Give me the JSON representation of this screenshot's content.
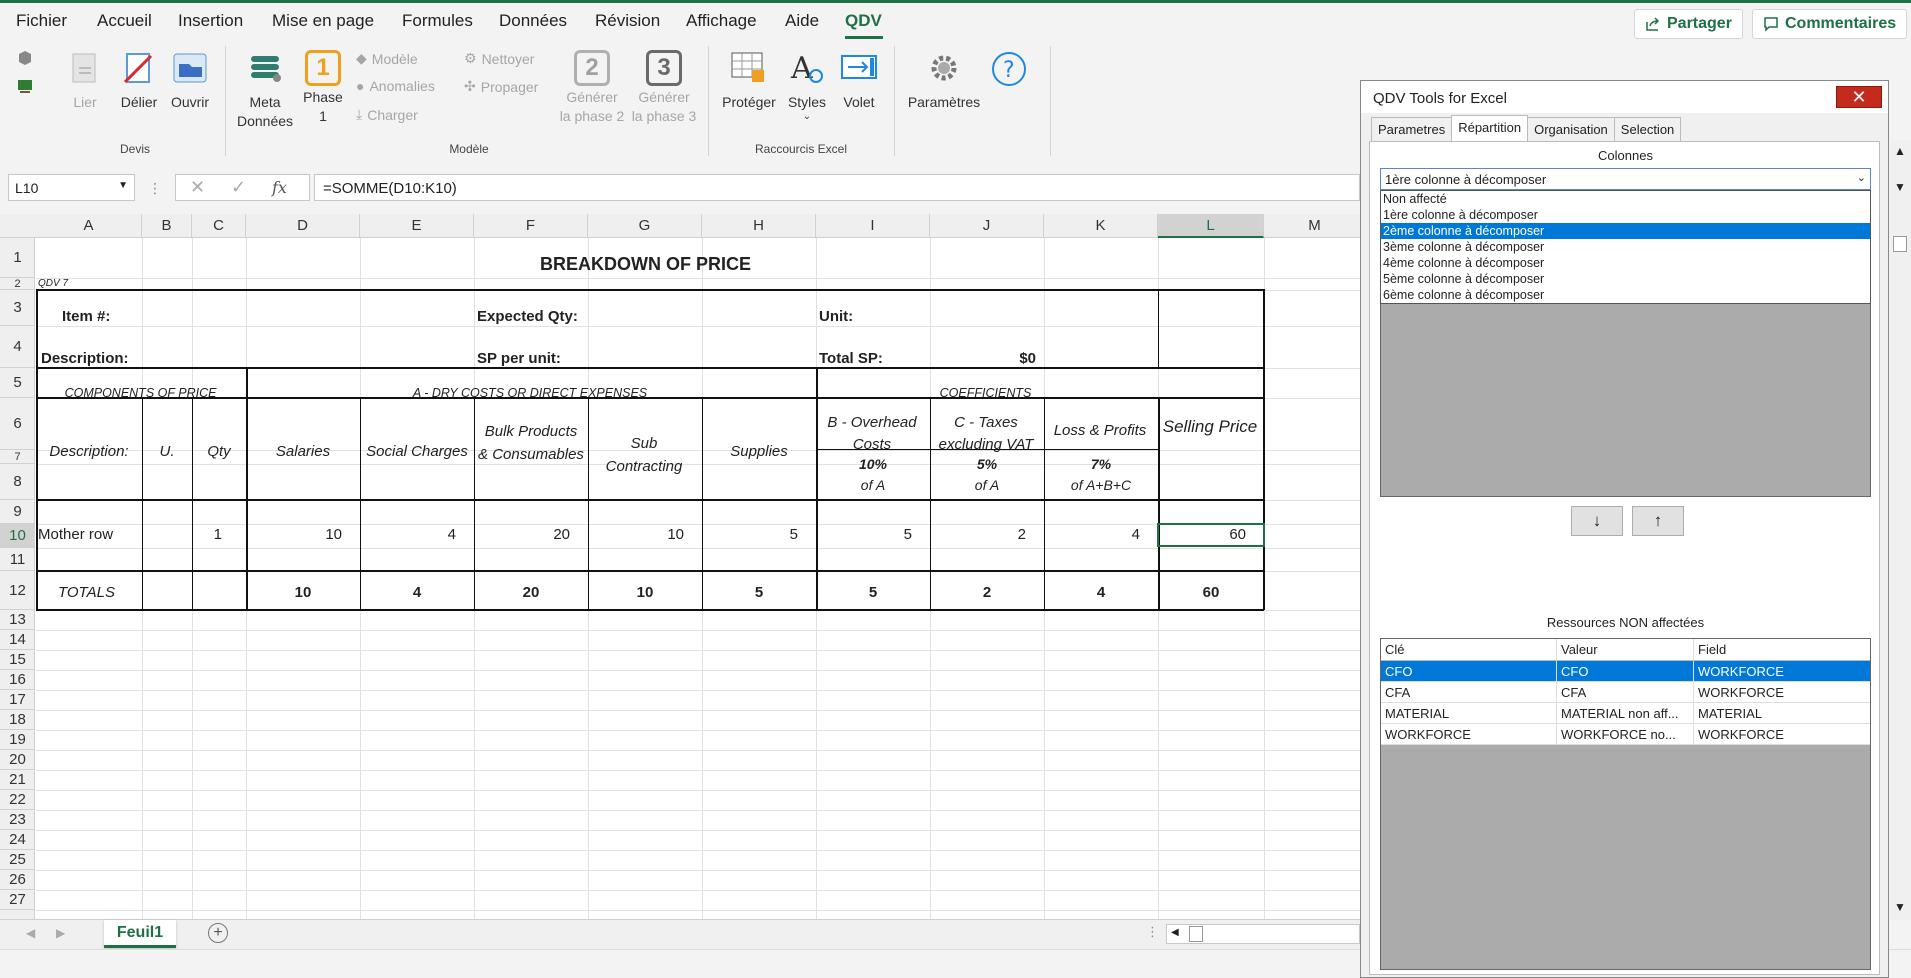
{
  "menu": {
    "items": [
      "Fichier",
      "Accueil",
      "Insertion",
      "Mise en page",
      "Formules",
      "Données",
      "Révision",
      "Affichage",
      "Aide",
      "QDV"
    ],
    "active": "QDV",
    "share": "Partager",
    "comments": "Commentaires"
  },
  "ribbon": {
    "lier": "Lier",
    "delier": "Délier",
    "ouvrir": "Ouvrir",
    "devis_group": "Devis",
    "meta1": "Meta",
    "meta2": "Données",
    "phase_num": "1",
    "phase_label1": "Phase",
    "phase_label2": "1",
    "modele": "Modèle",
    "anomalies": "Anomalies",
    "charger": "Charger",
    "nettoyer": "Nettoyer",
    "propager": "Propager",
    "phase2_num": "2",
    "gen2_1": "Générer",
    "gen2_2": "la phase 2",
    "phase3_num": "3",
    "gen3_1": "Générer",
    "gen3_2": "la phase 3",
    "modele_group": "Modèle",
    "proteger": "Protéger",
    "styles": "Styles",
    "volet": "Volet",
    "raccourcis_group": "Raccourcis Excel",
    "parametres": "Paramètres"
  },
  "formula_bar": {
    "name_box": "L10",
    "fx": "fx",
    "formula": "=SOMME(D10:K10)"
  },
  "sheet": {
    "columns": [
      "A",
      "B",
      "C",
      "D",
      "E",
      "F",
      "G",
      "H",
      "I",
      "J",
      "K",
      "L",
      "M"
    ],
    "title": "BREAKDOWN OF PRICE",
    "qdv7": "QDV 7",
    "item_label": "Item #:",
    "expected_qty": "Expected Qty:",
    "unit": "Unit:",
    "description_label": "Description:",
    "sp_per_unit": "SP per unit:",
    "total_sp": "Total SP:",
    "total_sp_value": "$0",
    "components": "COMPONENTS OF PRICE",
    "dry_costs": "A - DRY COSTS OR DIRECT EXPENSES",
    "coefficients": "COEFFICIENTS",
    "selling_price": "Selling Price",
    "hdr_description": "Description:",
    "hdr_u": "U.",
    "hdr_qty": "Qty",
    "hdr_salaries": "Salaries",
    "hdr_social": "Social Charges",
    "hdr_bulk": "Bulk Products & Consumables",
    "hdr_sub": "Sub Contracting",
    "hdr_supplies": "Supplies",
    "hdr_overhead": "B - Overhead Costs",
    "hdr_taxes": "C - Taxes excluding VAT",
    "hdr_loss": "Loss & Profits",
    "pct_overhead": "10%",
    "pct_taxes": "5%",
    "pct_loss": "7%",
    "of_overhead": "of A",
    "of_taxes": "of A",
    "of_loss": "of A+B+C",
    "mother_row": {
      "label": "Mother row",
      "qty": "1",
      "salaries": "10",
      "social": "4",
      "bulk": "20",
      "sub": "10",
      "supplies": "5",
      "overhead": "5",
      "taxes": "2",
      "loss": "4",
      "selling": "60"
    },
    "totals": {
      "label": "TOTALS",
      "salaries": "10",
      "social": "4",
      "bulk": "20",
      "sub": "10",
      "supplies": "5",
      "overhead": "5",
      "taxes": "2",
      "loss": "4",
      "selling": "60"
    },
    "tab": "Feuil1"
  },
  "panel": {
    "title": "QDV Tools for Excel",
    "tabs": [
      "Parametres",
      "Répartition",
      "Organisation",
      "Selection"
    ],
    "active_tab": "Répartition",
    "colonnes_label": "Colonnes",
    "combo_value": "1ère colonne à décomposer",
    "dropdown_items": [
      "Non affecté",
      "1ère colonne à décomposer",
      "2ème colonne à décomposer",
      "3ème colonne à décomposer",
      "4ème colonne à décomposer",
      "5ème colonne à décomposer",
      "6ème colonne à décomposer"
    ],
    "dropdown_selected": "2ème colonne à décomposer",
    "down_arrow": "↓",
    "up_arrow": "↑",
    "ressources_label": "Ressources NON affectées",
    "grid_headers": [
      "Clé",
      "Valeur",
      "Field"
    ],
    "grid_rows": [
      {
        "cle": "CFO",
        "valeur": "CFO",
        "field": "WORKFORCE"
      },
      {
        "cle": "CFA",
        "valeur": "CFA",
        "field": "WORKFORCE"
      },
      {
        "cle": "MATERIAL",
        "valeur": "MATERIAL non aff...",
        "field": "MATERIAL"
      },
      {
        "cle": "WORKFORCE",
        "valeur": "WORKFORCE no...",
        "field": "WORKFORCE"
      }
    ]
  },
  "colors": {
    "accent": "#1e7145",
    "selection": "#0078d7",
    "close": "#c42b1c"
  }
}
